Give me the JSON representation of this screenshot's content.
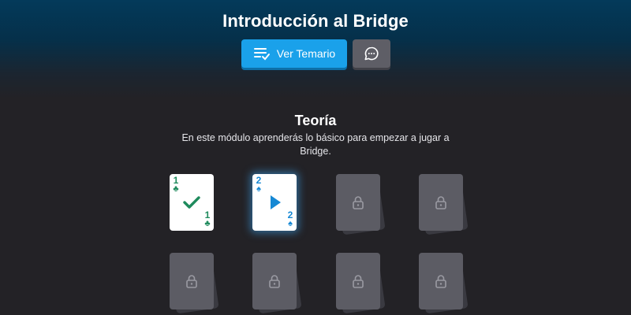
{
  "header": {
    "title": "Introducción al Bridge",
    "syllabus_label": "Ver Temario",
    "syllabus_icon": "list-check-icon",
    "chat_icon": "chat-bubble-icon"
  },
  "module": {
    "title": "Teoría",
    "description": "En este módulo aprenderás lo básico para empezar a jugar a Bridge."
  },
  "lessons": [
    {
      "state": "completed",
      "rank": "1",
      "suit": "♣",
      "color": "#1e8a5c",
      "icon": "checkmark-icon"
    },
    {
      "state": "current",
      "rank": "2",
      "suit": "♠",
      "color": "#1688d4",
      "icon": "play-icon"
    },
    {
      "state": "locked",
      "icon": "lock-icon"
    },
    {
      "state": "locked",
      "icon": "lock-icon"
    },
    {
      "state": "locked",
      "icon": "lock-icon"
    },
    {
      "state": "locked",
      "icon": "lock-icon"
    },
    {
      "state": "locked",
      "icon": "lock-icon"
    },
    {
      "state": "locked",
      "icon": "lock-icon"
    }
  ],
  "colors": {
    "accent": "#1aa1ea",
    "completed": "#1e8a5c",
    "current": "#1688d4",
    "locked": "#5c5c64"
  }
}
